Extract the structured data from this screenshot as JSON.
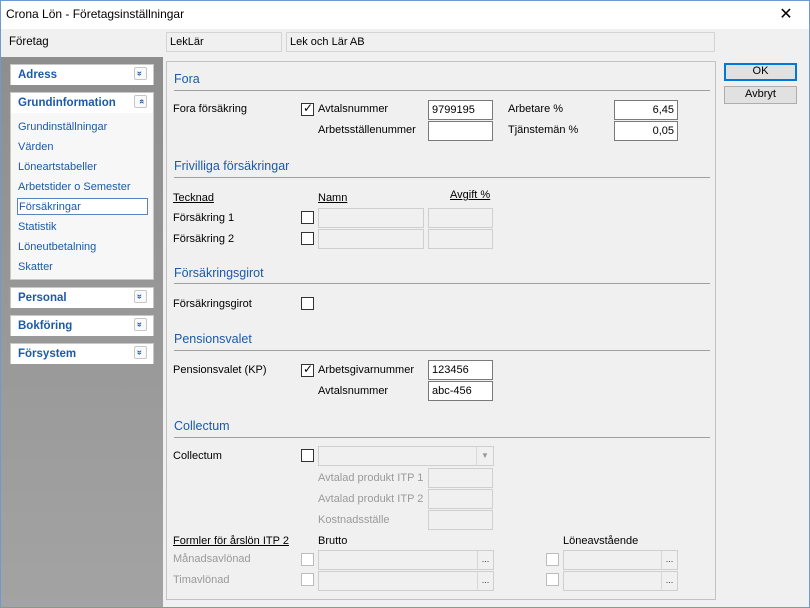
{
  "window": {
    "title": "Crona Lön - Företagsinställningar",
    "close_glyph": "✕"
  },
  "company": {
    "label": "Företag",
    "code": "LekLär",
    "name": "Lek och Lär AB"
  },
  "sidebar": {
    "panels": [
      {
        "label": "Adress",
        "expanded": false
      },
      {
        "label": "Grundinformation",
        "expanded": true
      },
      {
        "label": "Personal",
        "expanded": false
      },
      {
        "label": "Bokföring",
        "expanded": false
      },
      {
        "label": "Försystem",
        "expanded": false
      }
    ],
    "items": [
      "Grundinställningar",
      "Värden",
      "Löneartstabeller",
      "Arbetstider o Semester",
      "Försäkringar",
      "Statistik",
      "Löneutbetalning",
      "Skatter"
    ],
    "selected": "Försäkringar",
    "chevron_down": "»",
    "chevron_up": "«"
  },
  "buttons": {
    "ok": "OK",
    "cancel": "Avbryt"
  },
  "fora": {
    "title": "Fora",
    "row_label": "Fora försäkring",
    "checked": true,
    "avtal_label": "Avtalsnummer",
    "avtal_value": "9799195",
    "arbst_label": "Arbetsställenummer",
    "arbst_value": "",
    "arbetare_label": "Arbetare %",
    "arbetare_value": "6,45",
    "tjm_label": "Tjänstemän %",
    "tjm_value": "0,05"
  },
  "frivilliga": {
    "title": "Frivilliga försäkringar",
    "col_tecknad": "Tecknad",
    "col_namn": "Namn",
    "col_avgift": "Avgift %",
    "rows": [
      {
        "label": "Försäkring 1",
        "checked": false
      },
      {
        "label": "Försäkring 2",
        "checked": false
      }
    ]
  },
  "girot": {
    "title": "Försäkringsgirot",
    "label": "Försäkringsgirot",
    "checked": false
  },
  "pension": {
    "title": "Pensionsvalet",
    "label": "Pensionsvalet (KP)",
    "checked": true,
    "ag_label": "Arbetsgivarnummer",
    "ag_value": "123456",
    "avtal_label": "Avtalsnummer",
    "avtal_value": "abc-456"
  },
  "collectum": {
    "title": "Collectum",
    "label": "Collectum",
    "checked": false,
    "itp1": "Avtalad produkt ITP 1",
    "itp2": "Avtalad produkt ITP 2",
    "kst": "Kostnadsställe",
    "formler": "Formler för årslön ITP 2",
    "brutto": "Brutto",
    "loneav": "Löneavstående",
    "manad": "Månadsavlönad",
    "tim": "Timavlönad",
    "dots": "...",
    "dd_arrow": "▼"
  }
}
